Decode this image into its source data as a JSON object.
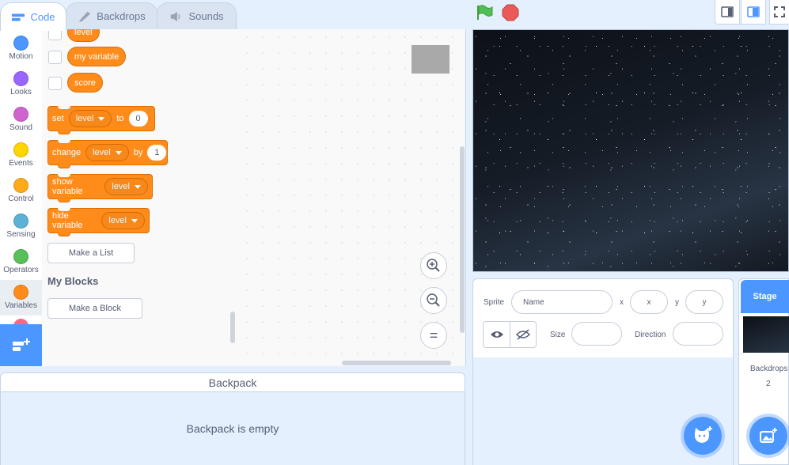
{
  "tabs": [
    {
      "label": "Code",
      "icon": "code-icon"
    },
    {
      "label": "Backdrops",
      "icon": "paintbrush-icon"
    },
    {
      "label": "Sounds",
      "icon": "speaker-icon"
    }
  ],
  "controls": {
    "green_flag": "green-flag-icon",
    "stop": "stop-icon"
  },
  "categories": [
    {
      "label": "Motion",
      "color": "#4c97ff"
    },
    {
      "label": "Looks",
      "color": "#9966ff"
    },
    {
      "label": "Sound",
      "color": "#cf63cf"
    },
    {
      "label": "Events",
      "color": "#ffd500"
    },
    {
      "label": "Control",
      "color": "#ffab19"
    },
    {
      "label": "Sensing",
      "color": "#5cb1d6"
    },
    {
      "label": "Operators",
      "color": "#59c059"
    },
    {
      "label": "Variables",
      "color": "#ff8c1a"
    }
  ],
  "palette": {
    "reporters": [
      "level",
      "my variable",
      "score"
    ],
    "set_block": {
      "verb": "set",
      "var": "level",
      "to": "to",
      "value": "0"
    },
    "change_block": {
      "verb": "change",
      "var": "level",
      "by": "by",
      "value": "1"
    },
    "show_block": {
      "verb": "show variable",
      "var": "level"
    },
    "hide_block": {
      "verb": "hide variable",
      "var": "level"
    },
    "make_list": "Make a List",
    "my_blocks_heading": "My Blocks",
    "make_block": "Make a Block"
  },
  "zoom": {
    "in": "+",
    "out": "−",
    "reset": "="
  },
  "backpack": {
    "title": "Backpack",
    "empty": "Backpack is empty"
  },
  "sprite_info": {
    "sprite_label": "Sprite",
    "name_placeholder": "Name",
    "x_label": "x",
    "x_placeholder": "x",
    "y_label": "y",
    "y_placeholder": "y",
    "size_label": "Size",
    "direction_label": "Direction"
  },
  "stage_panel": {
    "title": "Stage",
    "backdrops_label": "Backdrops",
    "backdrops_count": "2"
  }
}
